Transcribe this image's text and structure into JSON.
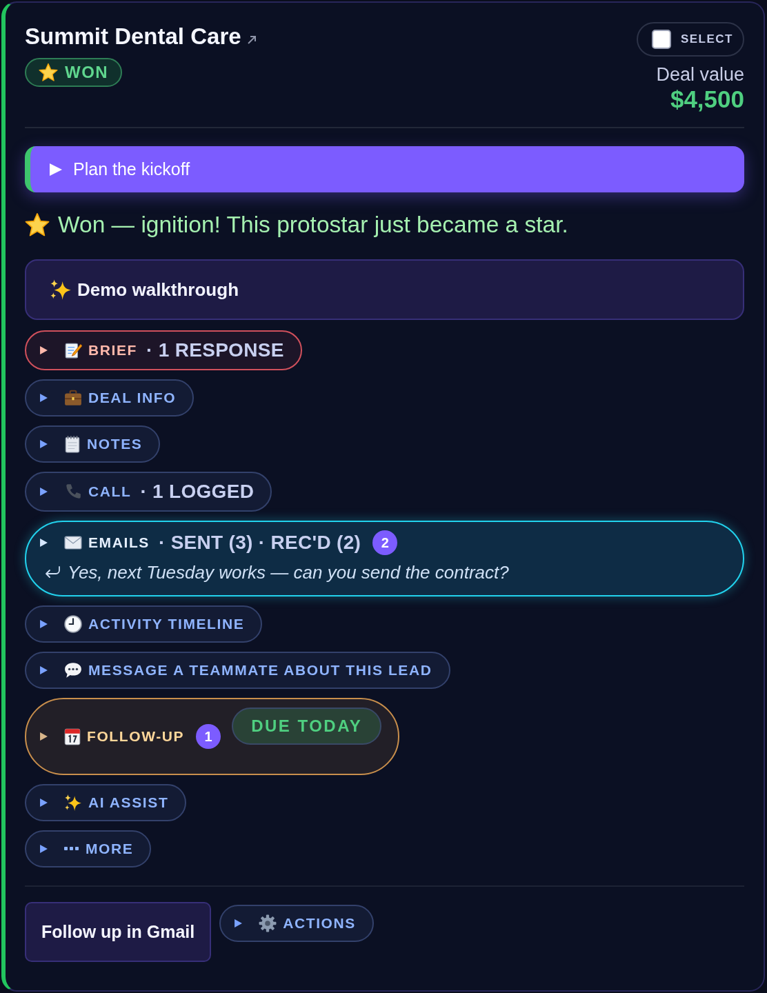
{
  "header": {
    "title": "Summit Dental Care",
    "status": "WON",
    "select": {
      "label": "SELECT",
      "checked": false
    },
    "deal_value": {
      "label": "Deal value",
      "amount": "$4,500"
    }
  },
  "next_step": {
    "label": "Plan the kickoff",
    "expanded": false
  },
  "message": "Won — ignition! This protostar just became a star.",
  "demo": {
    "title": "Demo walkthrough"
  },
  "sections": [
    {
      "kind": "alert",
      "label": "BRIEF",
      "detail": "· 1 RESPONSE",
      "expanded": false
    },
    {
      "kind": "plain",
      "label": "DEAL INFO",
      "expanded": false
    },
    {
      "kind": "plain",
      "label": "NOTES",
      "expanded": false
    },
    {
      "kind": "plain",
      "label": "CALL",
      "detail": "· 1 LOGGED",
      "expanded": false
    },
    {
      "kind": "highlight",
      "label": "EMAILS",
      "detail": "· SENT (3) · REC'D (2)",
      "count": "2",
      "preview": "Yes, next Tuesday works — can you send the contract?",
      "expanded": false
    },
    {
      "kind": "plain",
      "label": "ACTIVITY TIMELINE",
      "expanded": false
    },
    {
      "kind": "plain",
      "label": "MESSAGE A TEAMMATE ABOUT THIS LEAD",
      "expanded": false
    },
    {
      "kind": "due",
      "label": "FOLLOW-UP",
      "count": "1",
      "tag": "DUE TODAY",
      "expanded": false
    },
    {
      "kind": "plain",
      "label": "AI ASSIST",
      "expanded": false
    },
    {
      "kind": "plain",
      "label": "MORE",
      "expanded": false
    }
  ],
  "footer": {
    "primary_button": "Follow up in Gmail",
    "actions": {
      "label": "ACTIONS",
      "expanded": false
    }
  }
}
